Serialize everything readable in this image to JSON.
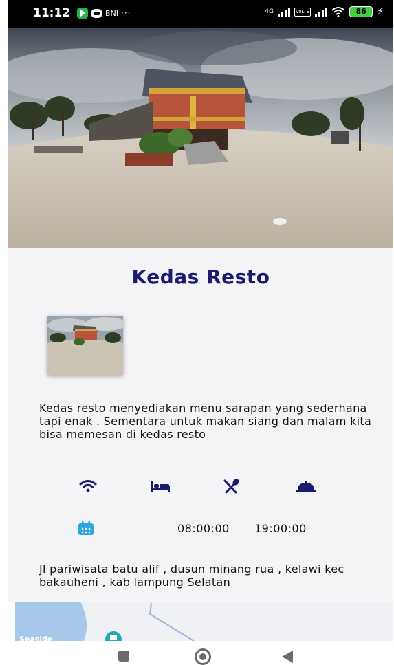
{
  "status_bar": {
    "time": "11:12",
    "bank_label": "BNI",
    "overflow": "···",
    "network_badge": "4G",
    "volte_badge": "VoLTE",
    "battery_level": "86",
    "icons": [
      "app-play-icon",
      "chat-icon",
      "signal-icon",
      "volte-icon",
      "signal-icon",
      "wifi-icon",
      "battery-icon",
      "charging-icon"
    ]
  },
  "place": {
    "name": "Kedas Resto",
    "description": "Kedas resto menyediakan menu sarapan yang sederhana tapi enak . Sementara untuk makan siang dan malam kita bisa memesan di kedas resto",
    "address": "Jl pariwisata batu alif , dusun minang rua , kelawi kec bakauheni , kab lampung Selatan"
  },
  "facilities": [
    {
      "name": "wifi",
      "icon": "wifi-icon"
    },
    {
      "name": "bed",
      "icon": "bed-icon"
    },
    {
      "name": "dining",
      "icon": "fork-spoon-icon"
    },
    {
      "name": "room-service",
      "icon": "cloche-icon"
    }
  ],
  "hours": {
    "icon": "calendar-icon",
    "open": "08:00:00",
    "close": "19:00:00"
  },
  "map": {
    "label": "Seaside"
  },
  "colors": {
    "title": "#1a1a6e",
    "icon_primary": "#1a1a6e",
    "icon_accent": "#2ba7e0",
    "map_water": "#a6c8ea"
  }
}
